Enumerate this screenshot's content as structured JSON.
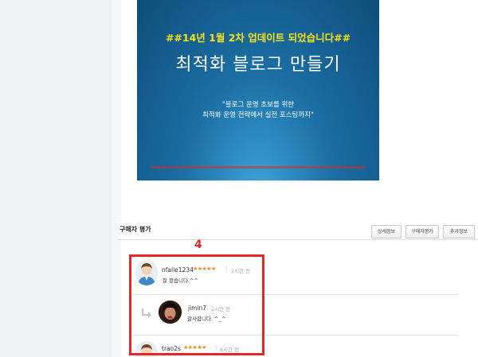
{
  "banner": {
    "update_notice": "##14년 1월 2차 업데이트 되었습니다##",
    "title": "최적화 블로그 만들기",
    "subtitle_line1": "\"블로그 운영 초보를 위한",
    "subtitle_line2": "최적화 운영 전략에서 실전 포스팅까지\""
  },
  "reviews": {
    "heading": "구매자 평가",
    "tabs": [
      "상세정보",
      "구매자평가",
      "추가정보"
    ],
    "annotation_number": "4",
    "items": [
      {
        "username": "nfalle1234",
        "stars": "★★★★★",
        "separator": "|",
        "time": "2시간 전",
        "comment": "잘 봤습니다.^^"
      },
      {
        "username": "jimin7",
        "separator": "|",
        "time": "2시간 전",
        "comment": "감사합니다. ^_^"
      },
      {
        "username": "trao2s",
        "stars": "★★★★★",
        "separator": "|",
        "time": "8시간 전"
      }
    ]
  },
  "colors": {
    "highlight": "#e8262a",
    "stars": "#f08a24",
    "banner_text_yellow": "#f5e21a"
  }
}
